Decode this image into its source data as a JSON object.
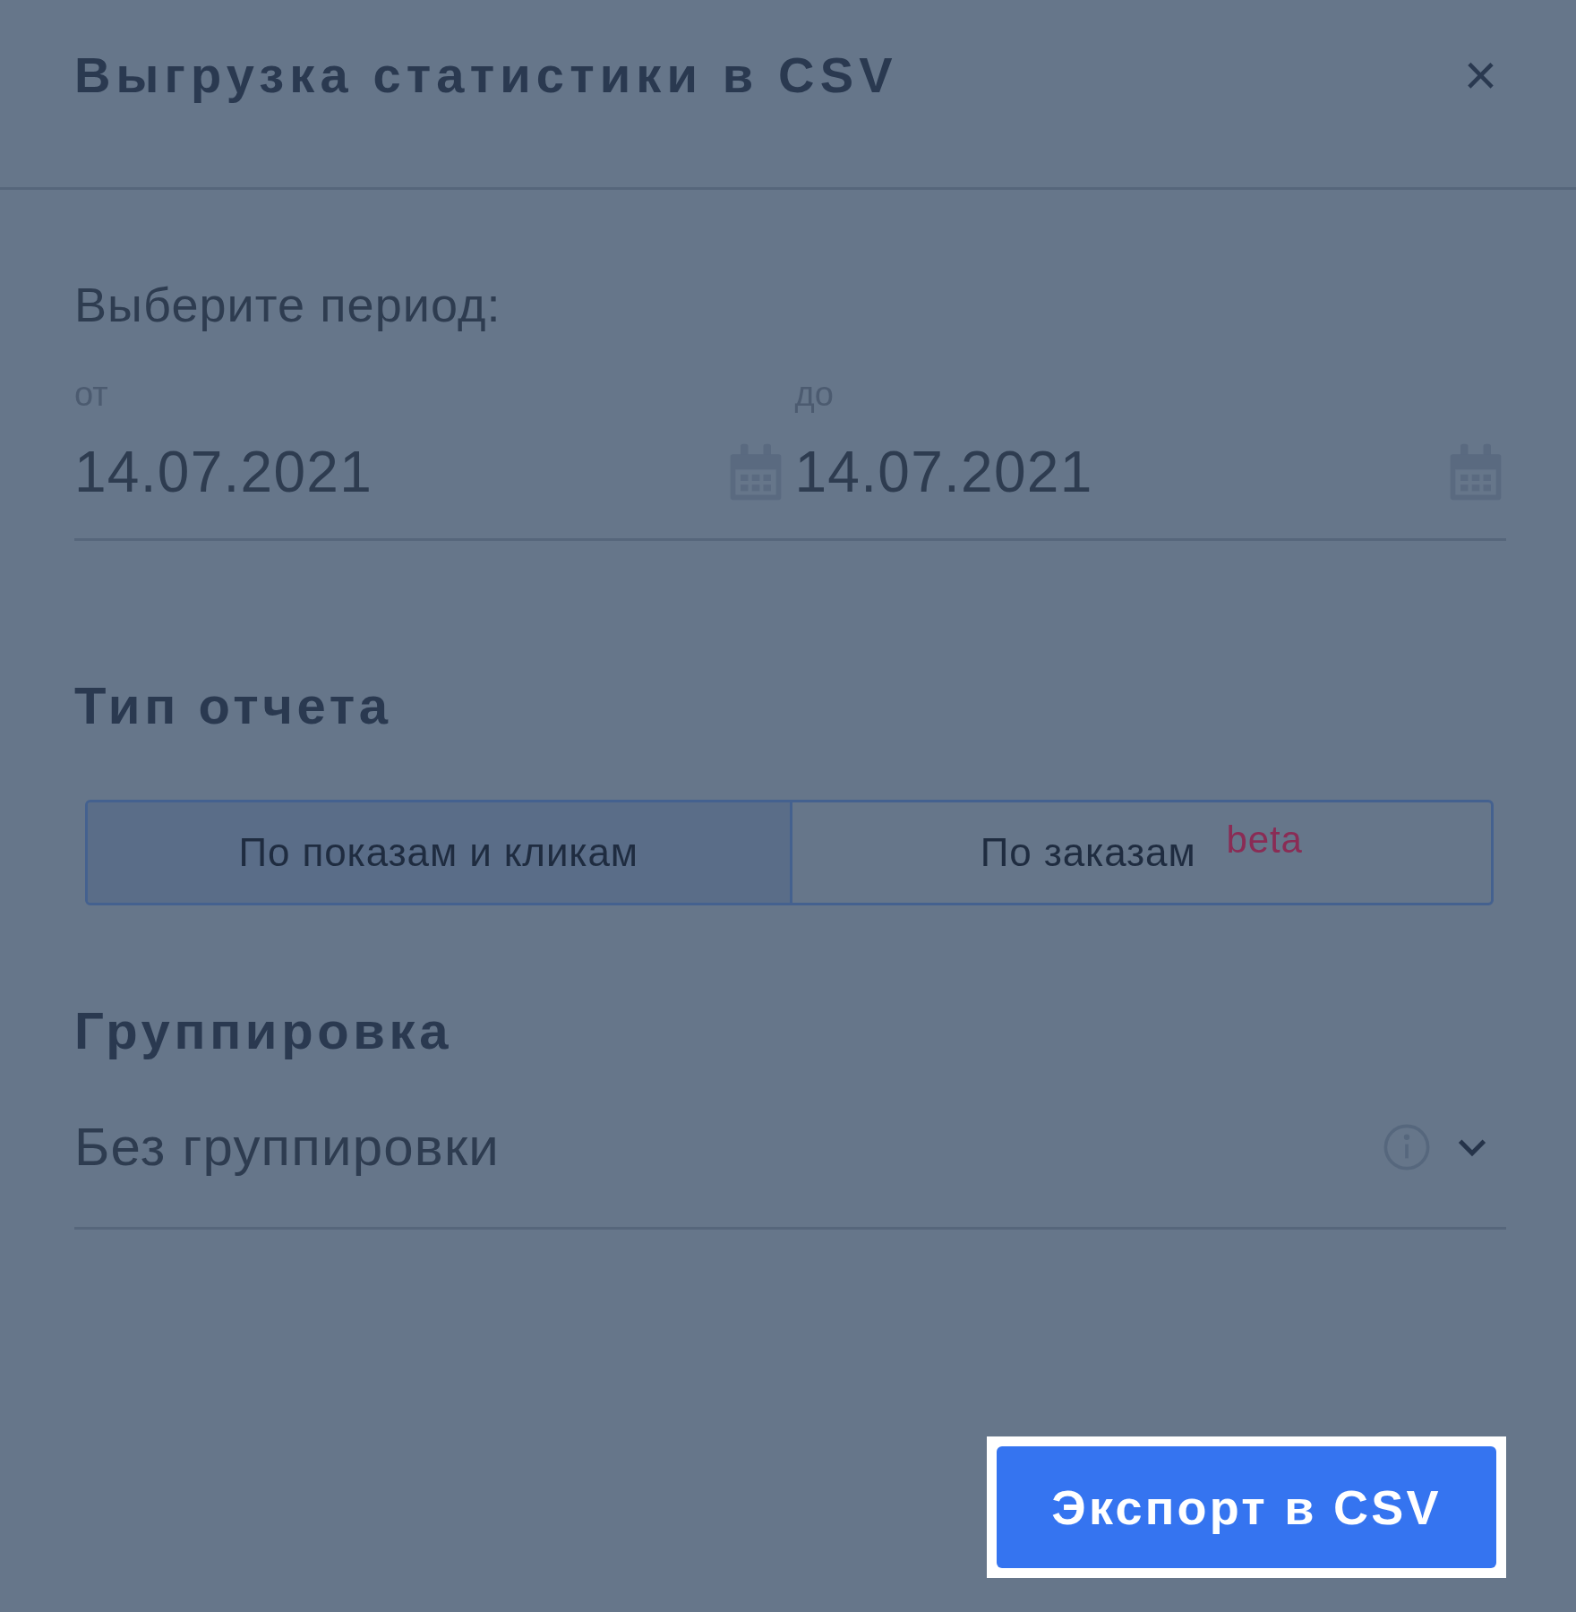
{
  "dialog": {
    "title": "Выгрузка статистики в CSV",
    "close": "×"
  },
  "period": {
    "label": "Выберите период:",
    "from": {
      "label": "от",
      "value": "14.07.2021"
    },
    "to": {
      "label": "до",
      "value": "14.07.2021"
    }
  },
  "report_type": {
    "heading": "Тип отчета",
    "options": [
      {
        "label": "По показам и кликам",
        "selected": true
      },
      {
        "label": "По заказам",
        "selected": false,
        "badge": "beta"
      }
    ]
  },
  "grouping": {
    "heading": "Группировка",
    "value": "Без группировки"
  },
  "export_button": "Экспорт в CSV"
}
